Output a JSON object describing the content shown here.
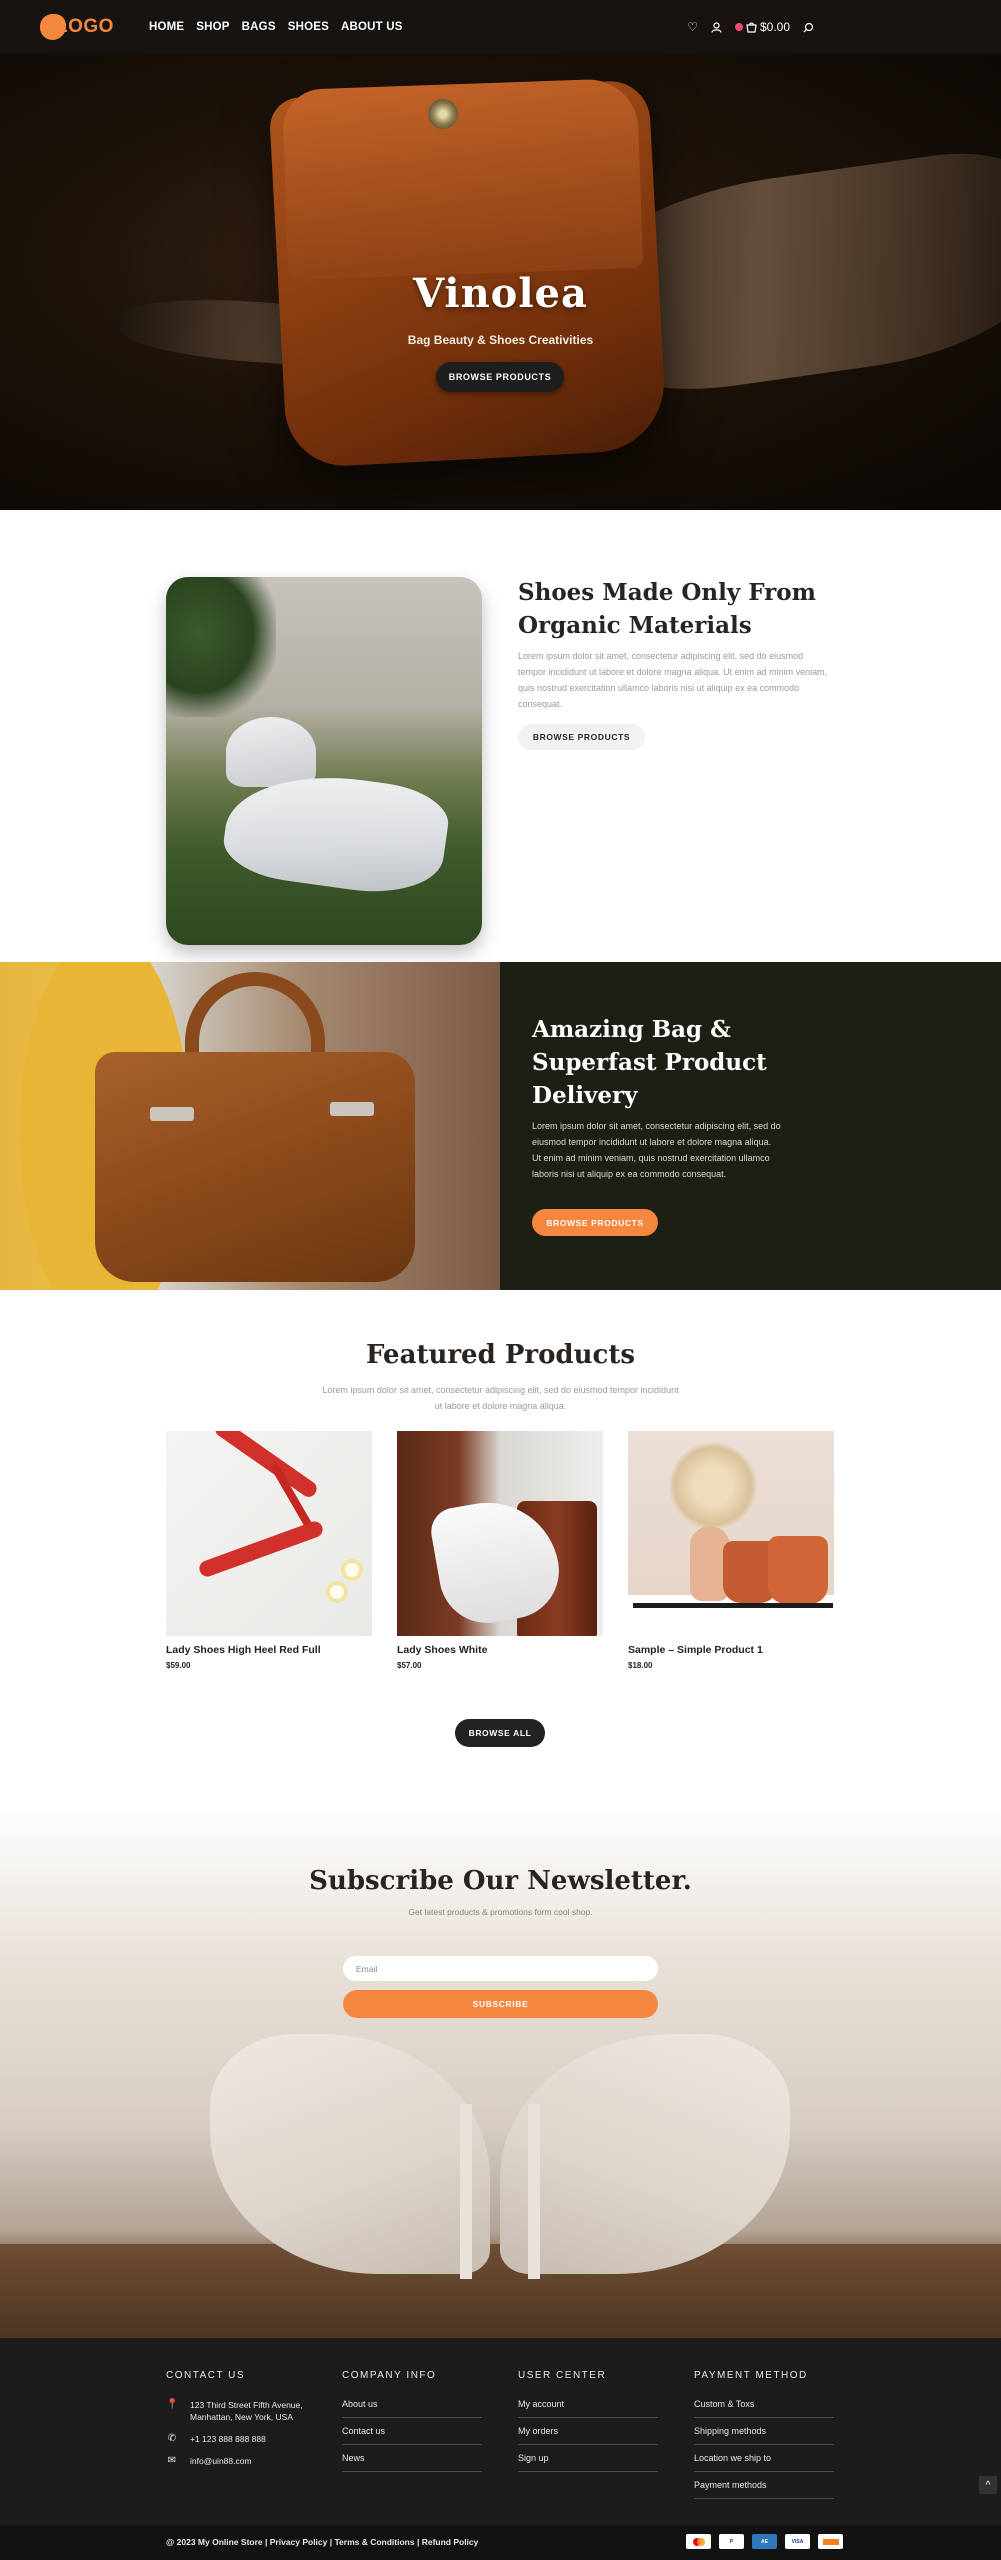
{
  "header": {
    "logo": "LOGO",
    "nav": [
      "HOME",
      "SHOP",
      "BAGS",
      "SHOES",
      "ABOUT US"
    ],
    "cart_total": "$0.00",
    "icons": [
      "heart-icon",
      "user-icon",
      "cart-icon",
      "search-icon"
    ]
  },
  "hero": {
    "title": "Vinolea",
    "subtitle": "Bag Beauty & Shoes Creativities",
    "button": "BROWSE PRODUCTS"
  },
  "organic": {
    "title": "Shoes Made Only From Organic Materials",
    "text": "Lorem ipsum dolor sit amet, consectetur adipiscing elit, sed do eiusmod tempor incididunt ut labore et dolore magna aliqua. Ut enim ad minim veniam, quis nostrud exercitation ullamco laboris nisi ut aliquip ex ea commodo consequat.",
    "button": "BROWSE PRODUCTS"
  },
  "bag": {
    "title": "Amazing Bag & Superfast Product Delivery",
    "text": "Lorem ipsum dolor sit amet, consectetur adipiscing elit, sed do eiusmod tempor incididunt ut labore et dolore magna aliqua. Ut enim ad minim veniam, quis nostrud exercitation ullamco laboris nisi ut aliquip ex ea commodo consequat.",
    "button": "BROWSE PRODUCTS"
  },
  "featured": {
    "title": "Featured Products",
    "subtitle": "Lorem ipsum dolor sit amet, consectetur adipiscing elit, sed do eiusmod tempor incididunt ut labore et dolore magna aliqua.",
    "products": [
      {
        "name": "Lady Shoes High Heel Red Full",
        "price": "$59.00"
      },
      {
        "name": "Lady Shoes White",
        "price": "$57.00"
      },
      {
        "name": "Sample – Simple Product 1",
        "price": "$18.00"
      }
    ],
    "button": "BROWSE ALL"
  },
  "newsletter": {
    "title": "Subscribe Our Newsletter.",
    "subtitle": "Get latest products & promotions form cool shop.",
    "email_placeholder": "Email",
    "button": "SUBSCRIBE"
  },
  "footer": {
    "contact": {
      "heading": "CONTACT US",
      "address": "123 Third Street Fifth Avenue, Manhattan, New York, USA",
      "phone": "+1 123 888 888 888",
      "email": "info@uin88.com"
    },
    "company": {
      "heading": "COMPANY INFO",
      "links": [
        "About us",
        "Contact us",
        "News"
      ]
    },
    "user": {
      "heading": "USER CENTER",
      "links": [
        "My account",
        "My orders",
        "Sign up"
      ]
    },
    "payment": {
      "heading": "PAYMENT METHOD",
      "links": [
        "Custom & Toxs",
        "Shipping methods",
        "Location we ship to",
        "Payment methods"
      ]
    },
    "copyright": "@ 2023 My Online Store | Privacy Policy | Terms & Conditions | Refund Policy",
    "pay_icons": [
      "mastercard-icon",
      "paypal-icon",
      "amex-icon",
      "visa-icon",
      "discover-icon"
    ]
  },
  "colors": {
    "accent": "#f5873e",
    "dark": "#1c1c1c",
    "olive": "#1c1f14"
  }
}
